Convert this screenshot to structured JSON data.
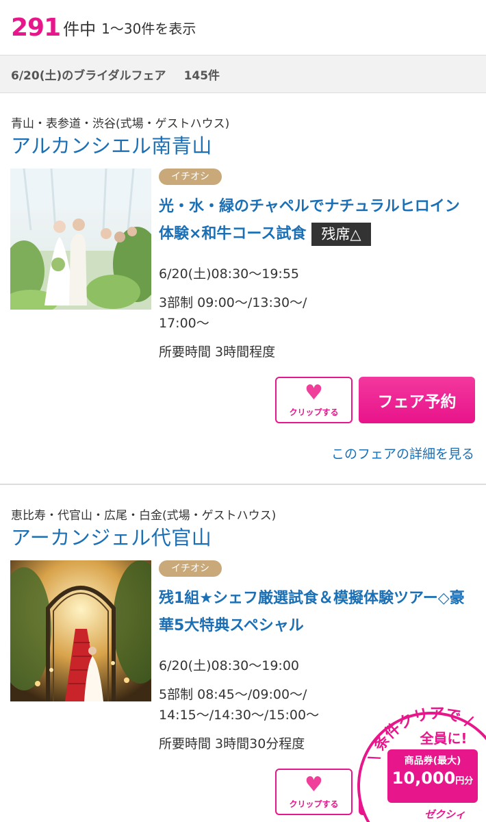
{
  "summary": {
    "total": "291",
    "unit": "件中",
    "range": "1〜30件を表示"
  },
  "date_bar": {
    "label": "6/20(土)のブライダルフェア",
    "count": "145件"
  },
  "fairs": [
    {
      "area": "青山・表参道・渋谷(式場・ゲストハウス)",
      "venue": "アルカンシエル南青山",
      "badge": "イチオシ",
      "title": "光・水・緑のチャペルでナチュラルヒロイン体験×和牛コース試食",
      "seat": "残席△",
      "datetime": "6/20(土)08:30〜19:55",
      "schedule_1": "3部制 09:00〜/13:30〜/",
      "schedule_2": "17:00〜",
      "duration": "所要時間 3時間程度",
      "clip_label": "クリップする",
      "reserve_label": "フェア予約",
      "detail_link": "このフェアの詳細を見る"
    },
    {
      "area": "恵比寿・代官山・広尾・白金(式場・ゲストハウス)",
      "venue": "アーカンジェル代官山",
      "badge": "イチオシ",
      "title": "残1組★シェフ厳選試食＆模擬体験ツアー◇豪華5大特典スペシャル",
      "datetime": "6/20(土)08:30〜19:00",
      "schedule_1": "5部制 08:45〜/09:00〜/",
      "schedule_2": "14:15〜/14:30〜/15:00〜",
      "duration": "所要時間 3時間30分程度",
      "clip_label": "クリップする"
    }
  ],
  "promo": {
    "arc_text": "条件クリアで",
    "line1": "全員に!",
    "line2": "商品券(最大)",
    "amount": "10,000",
    "amount_unit": "円分",
    "brand": "ゼクシィ"
  },
  "colors": {
    "accent": "#e8168b",
    "link": "#1a6fb5",
    "badge": "#c9a97a"
  }
}
